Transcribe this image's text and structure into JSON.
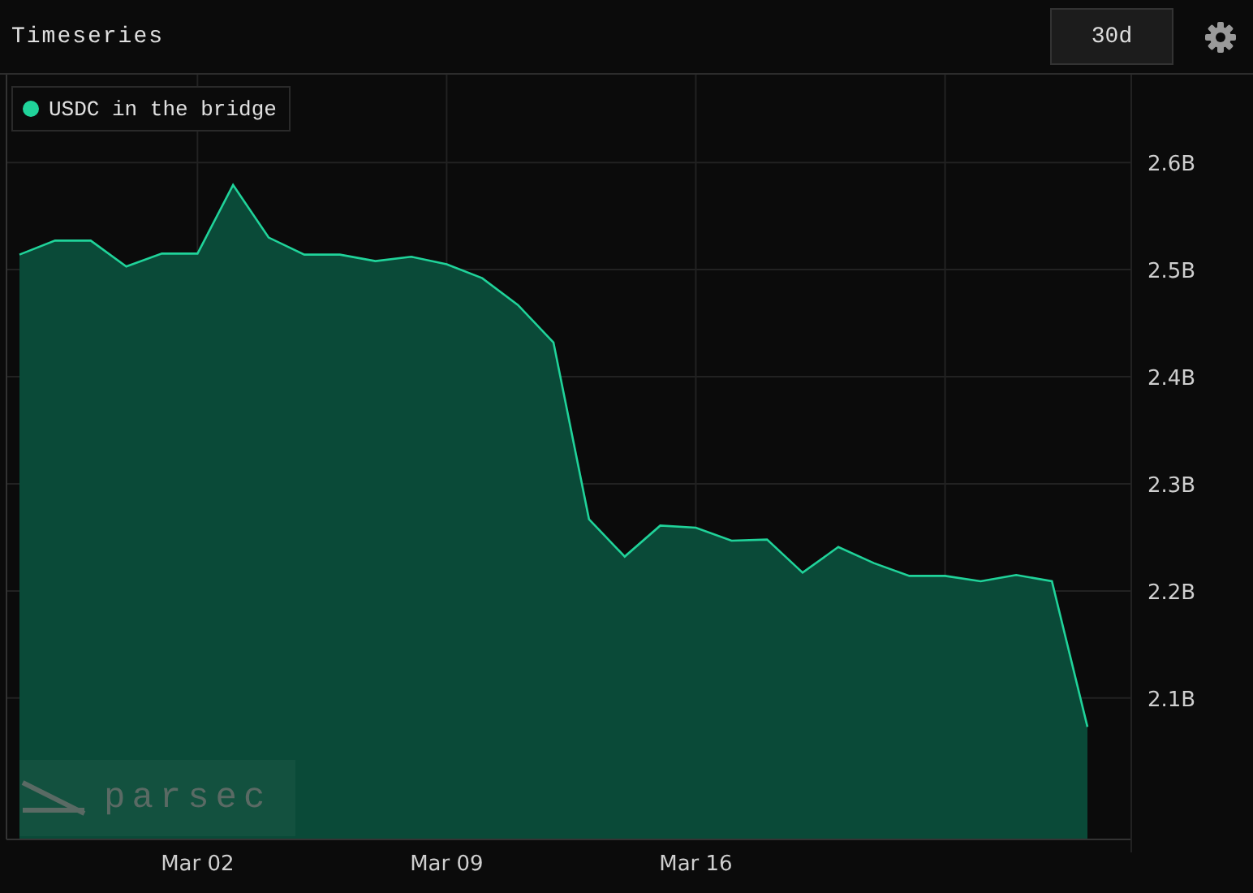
{
  "panel": {
    "title": "Timeseries",
    "range_button": "30d"
  },
  "chart": {
    "watermark": "parsec",
    "chart_data": {
      "type": "area",
      "grid": true,
      "ylim": [
        1.968,
        2.682
      ],
      "yticks": [
        {
          "value": 2.1,
          "label": "2.1B"
        },
        {
          "value": 2.2,
          "label": "2.2B"
        },
        {
          "value": 2.3,
          "label": "2.3B"
        },
        {
          "value": 2.4,
          "label": "2.4B"
        },
        {
          "value": 2.5,
          "label": "2.5B"
        },
        {
          "value": 2.6,
          "label": "2.6B"
        }
      ],
      "categories": [
        null,
        null,
        null,
        null,
        null,
        "Mar 02",
        null,
        null,
        null,
        null,
        null,
        null,
        "Mar 09",
        null,
        null,
        null,
        null,
        null,
        null,
        "Mar 16",
        null,
        null,
        null,
        null,
        null,
        null,
        null,
        null,
        null,
        null,
        null
      ],
      "series": [
        {
          "name": "USDC in the bridge",
          "color": "#20d39a",
          "values": [
            2.514,
            2.527,
            2.527,
            2.503,
            2.515,
            2.515,
            2.579,
            2.53,
            2.514,
            2.514,
            2.508,
            2.512,
            2.505,
            2.492,
            2.467,
            2.432,
            2.267,
            2.232,
            2.261,
            2.259,
            2.247,
            2.248,
            2.217,
            2.241,
            2.226,
            2.214,
            2.214,
            2.209,
            2.215,
            2.209,
            2.073
          ]
        }
      ]
    }
  }
}
